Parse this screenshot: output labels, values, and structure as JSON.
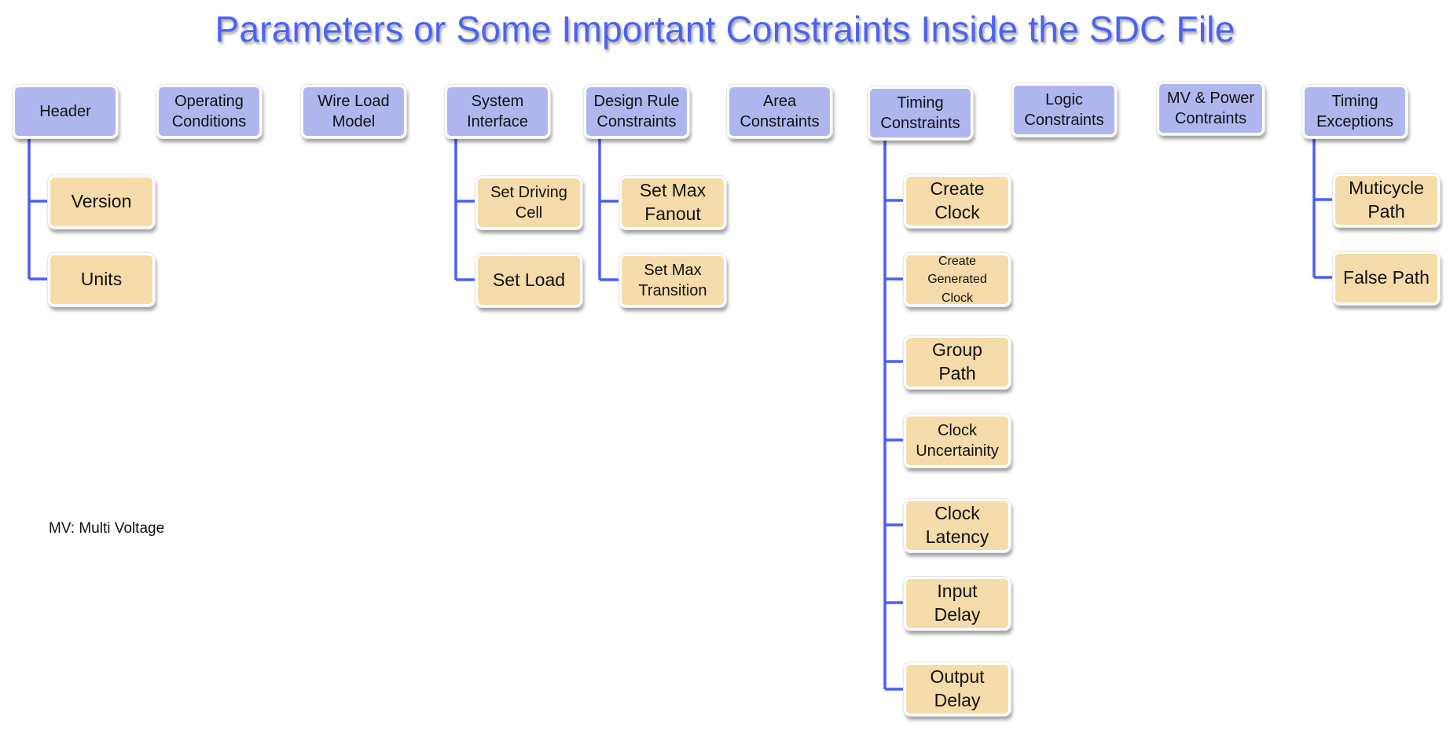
{
  "title": "Parameters or Some Important Constraints Inside the SDC File",
  "note": "MV: Multi Voltage",
  "colors": {
    "title": "#4a63f0",
    "top_box": "#b0b7ef",
    "child_box": "#f6dcaa",
    "connector": "#4a5ef5"
  },
  "categories": [
    {
      "label": "Header",
      "children": [
        "Version",
        "Units"
      ]
    },
    {
      "label": "Operating\nConditions",
      "children": []
    },
    {
      "label": "Wire Load\nModel",
      "children": []
    },
    {
      "label": "System\nInterface",
      "children": [
        "Set Driving\nCell",
        "Set Load"
      ]
    },
    {
      "label": "Design Rule\nConstraints",
      "children": [
        "Set Max\nFanout",
        "Set Max\nTransition"
      ]
    },
    {
      "label": "Area\nConstraints",
      "children": []
    },
    {
      "label": "Timing\nConstraints",
      "children": [
        "Create\nClock",
        "Create\nGenerated\nClock",
        "Group\nPath",
        "Clock\nUncertainity",
        "Clock\nLatency",
        "Input\nDelay",
        "Output\nDelay"
      ]
    },
    {
      "label": "Logic\nConstraints",
      "children": []
    },
    {
      "label": "MV & Power\nContraints",
      "children": []
    },
    {
      "label": "Timing\nExceptions",
      "children": [
        "Muticycle\nPath",
        "False Path"
      ]
    }
  ]
}
